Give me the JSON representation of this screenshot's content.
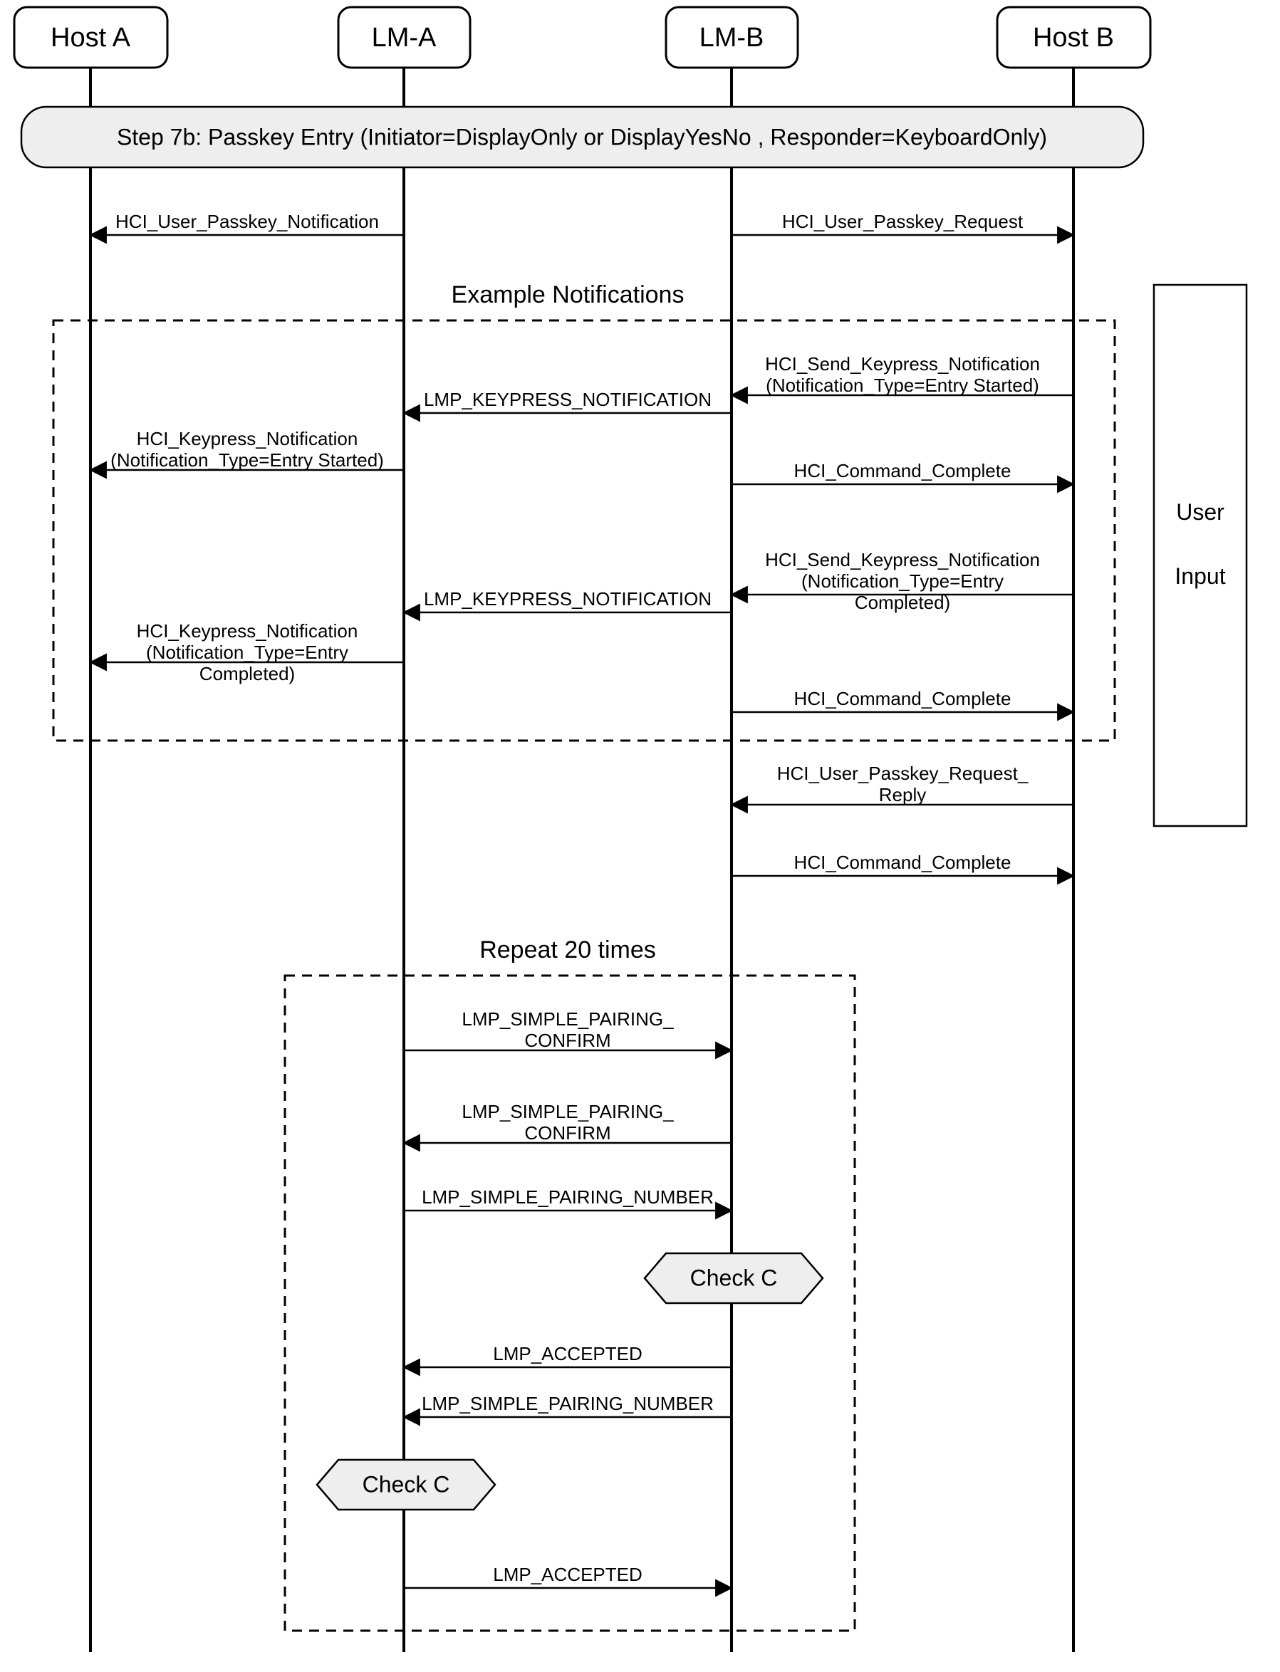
{
  "lanes": {
    "hostA": "Host A",
    "lmA": "LM-A",
    "lmB": "LM-B",
    "hostB": "Host B"
  },
  "step": "Step 7b:  Passkey Entry (Initiator=DisplayOnly or DisplayYesNo , Responder=KeyboardOnly)",
  "sections": {
    "example": "Example Notifications",
    "repeat": "Repeat 20 times",
    "userInput1": "User",
    "userInput2": "Input"
  },
  "messages": {
    "m1": "HCI_User_Passkey_Notification",
    "m2": "HCI_User_Passkey_Request",
    "m3a": "HCI_Send_Keypress_Notification",
    "m3b": "(Notification_Type=Entry Started)",
    "m4": "LMP_KEYPRESS_NOTIFICATION",
    "m5a": "HCI_Keypress_Notification",
    "m5b": "(Notification_Type=Entry Started)",
    "m6": "HCI_Command_Complete",
    "m7a": "HCI_Send_Keypress_Notification",
    "m7b": "(Notification_Type=Entry",
    "m7c": "Completed)",
    "m8": "LMP_KEYPRESS_NOTIFICATION",
    "m9a": "HCI_Keypress_Notification",
    "m9b": "(Notification_Type=Entry",
    "m9c": "Completed)",
    "m10": "HCI_Command_Complete",
    "m11a": "HCI_User_Passkey_Request_",
    "m11b": "Reply",
    "m12": "HCI_Command_Complete",
    "m13a": "LMP_SIMPLE_PAIRING_",
    "m13b": "CONFIRM",
    "m14a": "LMP_SIMPLE_PAIRING_",
    "m14b": "CONFIRM",
    "m15": "LMP_SIMPLE_PAIRING_NUMBER",
    "m16": "LMP_ACCEPTED",
    "m17": "LMP_SIMPLE_PAIRING_NUMBER",
    "m18": "LMP_ACCEPTED"
  },
  "checks": {
    "c1": "Check C",
    "c2": "Check C"
  }
}
